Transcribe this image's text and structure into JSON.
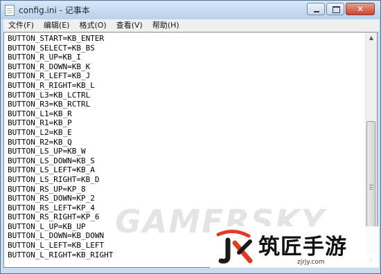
{
  "window": {
    "title": "config.ini - 记事本",
    "controls": {
      "minimize_icon": "minimize-icon",
      "maximize_icon": "maximize-icon",
      "close_icon": "close-icon",
      "close_glyph": "✕"
    }
  },
  "menu": [
    "文件(F)",
    "编辑(E)",
    "格式(O)",
    "查看(V)",
    "帮助(H)"
  ],
  "editor_lines": [
    "BUTTON_START=KB_ENTER",
    "BUTTON_SELECT=KB_BS",
    "BUTTON_R_UP=KB_I",
    "BUTTON_R_DOWN=KB_K",
    "BUTTON_R_LEFT=KB_J",
    "BUTTON_R_RIGHT=KB_L",
    "BUTTON_L3=KB_LCTRL",
    "BUTTON_R3=KB_RCTRL",
    "BUTTON_L1=KB_R",
    "BUTTON_R1=KB_P",
    "BUTTON_L2=KB_E",
    "BUTTON_R2=KB_Q",
    "BUTTON_LS_UP=KB_W",
    "BUTTON_LS_DOWN=KB_S",
    "BUTTON_LS_LEFT=KB_A",
    "BUTTON_LS_RIGHT=KB_D",
    "BUTTON_RS_UP=KP_8",
    "BUTTON_RS_DOWN=KP_2",
    "BUTTON_RS_LEFT=KP_4",
    "BUTTON_RS_RIGHT=KP_6",
    "BUTTON_L_UP=KB_UP",
    "BUTTON_L_DOWN=KB_DOWN",
    "BUTTON_L_LEFT=KB_LEFT",
    "BUTTON_L_RIGHT=KB_RIGHT"
  ],
  "scrollbar": {
    "up_glyph": "▲",
    "down_glyph": "▼"
  },
  "watermark": {
    "text": "GAMERSKY"
  },
  "logo": {
    "mark_text": "JS",
    "name": "筑匠手游",
    "url": "zjrjy.com"
  }
}
